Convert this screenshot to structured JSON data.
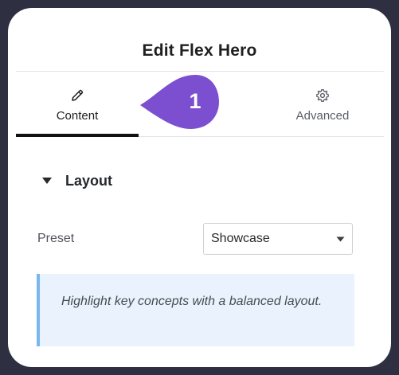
{
  "panel": {
    "title": "Edit Flex Hero"
  },
  "tabs": [
    {
      "label": "Content",
      "icon": "pencil-icon",
      "active": true
    },
    {
      "label": "Advanced",
      "icon": "gear-icon",
      "active": false
    }
  ],
  "badge": {
    "number": "1",
    "color": "#7b4fcf"
  },
  "section": {
    "title": "Layout",
    "icon": "caret-down-icon",
    "expanded": true
  },
  "preset": {
    "label": "Preset",
    "value": "Showcase",
    "icon": "chevron-down-icon"
  },
  "notice": {
    "text": "Highlight key concepts with a balanced layout.",
    "accent_color": "#7ab6ef",
    "background_color": "#eaf3fd"
  },
  "colors": {
    "frame": "#2e2f40",
    "panel": "#ffffff",
    "active_tab_underline": "#111111"
  }
}
